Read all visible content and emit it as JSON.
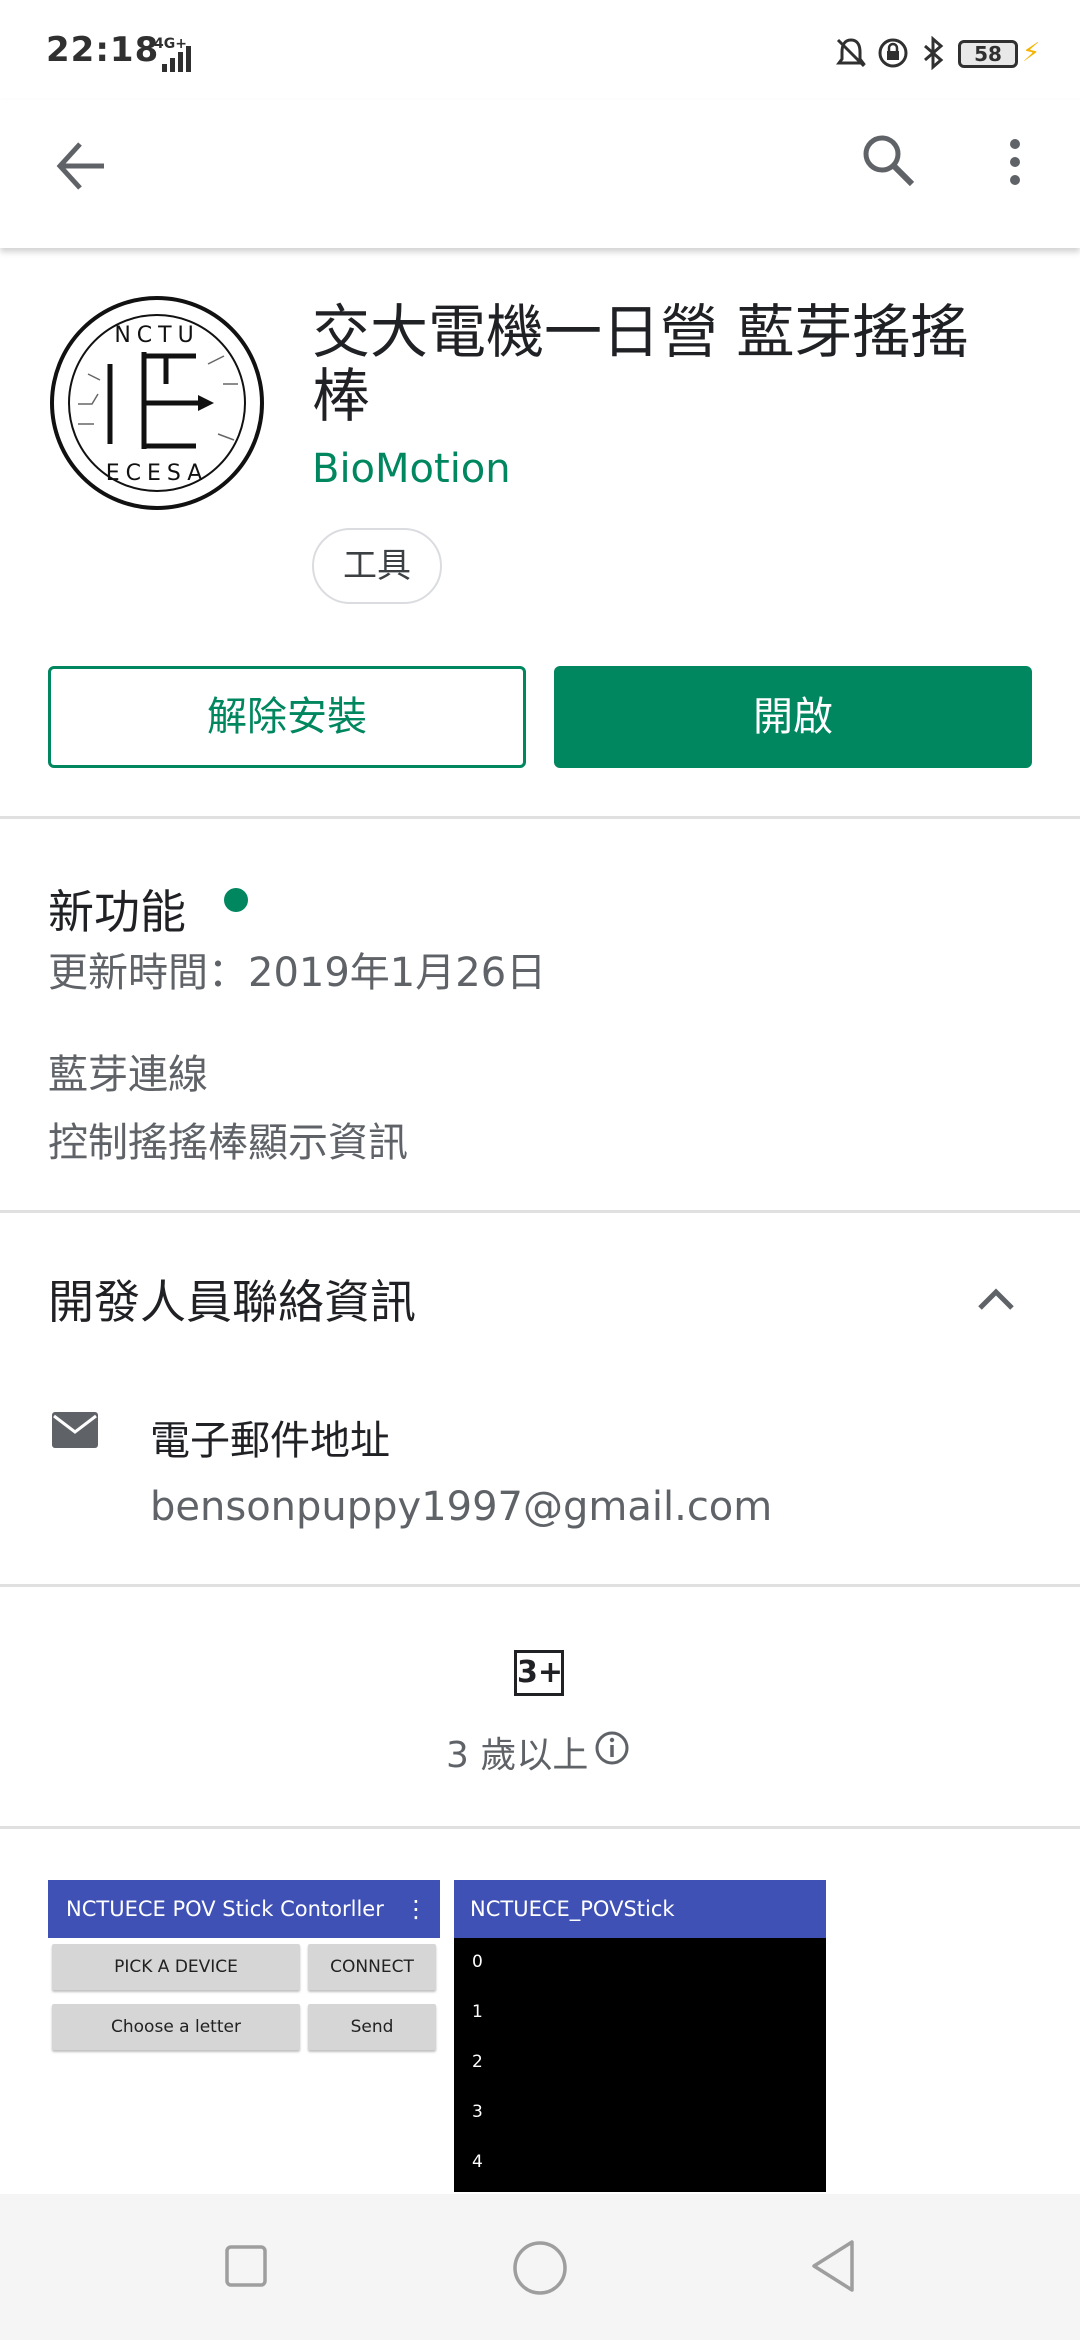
{
  "status_bar": {
    "time": "22:18",
    "network": "4G+",
    "battery": "58",
    "icons": [
      "signal-icon",
      "mute-bell-icon",
      "rotation-lock-icon",
      "bluetooth-icon",
      "battery-icon",
      "charging-icon"
    ]
  },
  "app_bar": {
    "icons": [
      "back-arrow-icon",
      "search-icon",
      "more-vert-icon"
    ]
  },
  "app": {
    "title": "交大電機一日營 藍芽搖搖棒",
    "developer": "BioMotion",
    "category_chip": "工具",
    "logo_text_top": "NCTU",
    "logo_text_bottom": "ECESA",
    "uninstall_label": "解除安裝",
    "open_label": "開啟"
  },
  "whats_new": {
    "title": "新功能",
    "date": "更新時間：2019年1月26日",
    "lines": [
      "藍芽連線",
      "控制搖搖棒顯示資訊"
    ]
  },
  "developer_contact": {
    "title": "開發人員聯絡資訊",
    "email_label": "電子郵件地址",
    "email": "bensonpuppy1997@gmail.com"
  },
  "rating": {
    "badge": "3+",
    "text": "3 歲以上"
  },
  "screenshots": {
    "shot1": {
      "title": "NCTUECE POV Stick Contorller",
      "buttons": [
        "PICK A DEVICE",
        "CONNECT",
        "Choose a letter",
        "Send"
      ]
    },
    "shot2": {
      "title": "NCTUECE_POVStick",
      "rows": [
        "0",
        "1",
        "2",
        "3",
        "4"
      ]
    }
  },
  "colors": {
    "accent": "#01875f",
    "screenshot_bar": "#3f51b5"
  }
}
